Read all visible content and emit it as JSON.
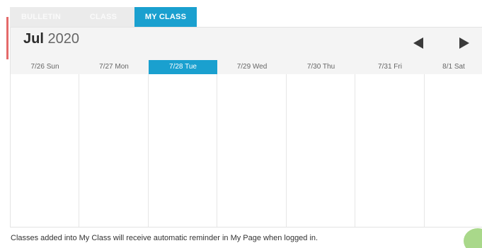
{
  "tabs": [
    {
      "label": "BULLETIN",
      "active": false
    },
    {
      "label": "CLASS",
      "active": false
    },
    {
      "label": "MY CLASS",
      "active": true
    }
  ],
  "calendar": {
    "month": "Jul",
    "year": "2020",
    "prev_icon": "triangle-left-icon",
    "next_icon": "triangle-right-icon",
    "days": [
      {
        "label": "7/26 Sun",
        "today": false
      },
      {
        "label": "7/27 Mon",
        "today": false
      },
      {
        "label": "7/28 Tue",
        "today": true
      },
      {
        "label": "7/29 Wed",
        "today": false
      },
      {
        "label": "7/30 Thu",
        "today": false
      },
      {
        "label": "7/31 Fri",
        "today": false
      },
      {
        "label": "8/1 Sat",
        "today": false
      }
    ]
  },
  "footer": {
    "note": "Classes added into My Class will receive automatic reminder in My Page when logged in."
  },
  "colors": {
    "accent": "#1aa0cf",
    "inactive_tab": "#ebebeb",
    "header_bg": "#f4f4f4"
  }
}
